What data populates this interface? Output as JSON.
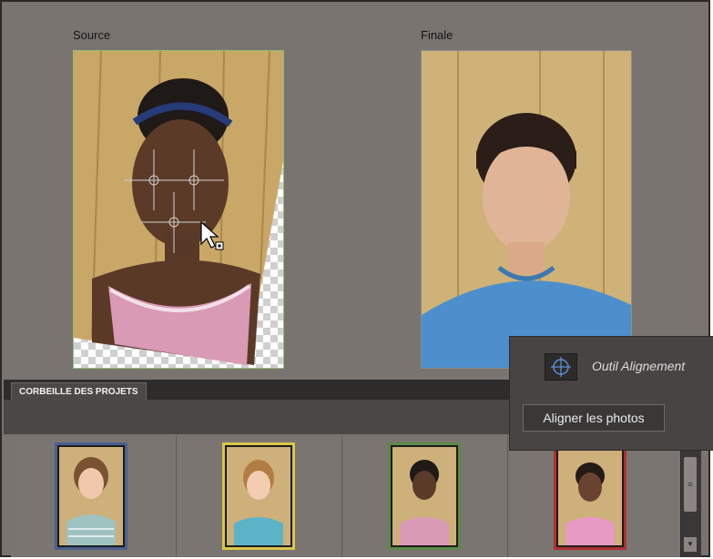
{
  "panels": {
    "source_label": "Source",
    "final_label": "Finale"
  },
  "photo_bin": {
    "tab_label": "CORBEILLE DES PROJETS",
    "thumbnails": [
      {
        "frame_color": "#4a5f8c",
        "name": "girl-striped-shirt"
      },
      {
        "frame_color": "#d8c54a",
        "name": "girl-blue-top"
      },
      {
        "frame_color": "#5b8a45",
        "name": "girl-pink-top-smile"
      },
      {
        "frame_color": "#b03030",
        "name": "girl-pink-shirt"
      }
    ]
  },
  "tool_popup": {
    "tool_name": "Outil Alignement",
    "align_button": "Aligner les photos"
  },
  "icons": {
    "tool_icon": "crosshair-target-icon",
    "cursor": "arrow-cursor-icon"
  }
}
